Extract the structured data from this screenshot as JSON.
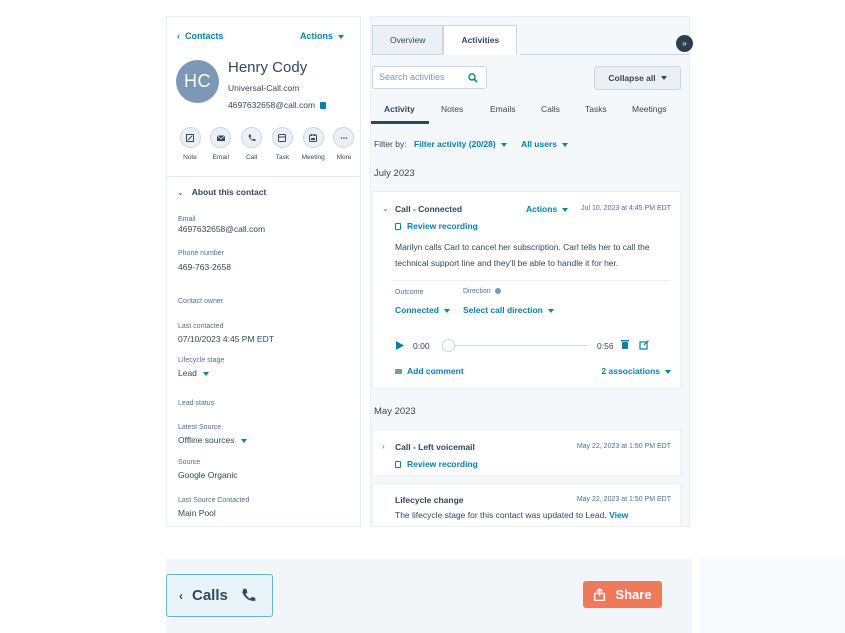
{
  "contact_panel": {
    "back_label": "Contacts",
    "actions_label": "Actions",
    "avatar_initials": "HC",
    "name": "Henry Cody",
    "domain": "Universal-Call.com",
    "email": "4697632658@call.com",
    "quick_actions": [
      {
        "label": "Note",
        "icon": "note-icon"
      },
      {
        "label": "Email",
        "icon": "email-icon"
      },
      {
        "label": "Call",
        "icon": "call-icon"
      },
      {
        "label": "Task",
        "icon": "task-icon"
      },
      {
        "label": "Meeting",
        "icon": "meeting-icon"
      },
      {
        "label": "More",
        "icon": "more-icon"
      }
    ],
    "about_title": "About this contact",
    "properties": {
      "email": {
        "label": "Email",
        "value": "4697632658@call.com"
      },
      "phone": {
        "label": "Phone number",
        "value": "469-763-2658"
      },
      "owner": {
        "label": "Contact owner",
        "value": ""
      },
      "last_contacted": {
        "label": "Last contacted",
        "value": "07/10/2023 4:45 PM EDT"
      },
      "lifecycle": {
        "label": "Lifecycle stage",
        "value": "Lead"
      },
      "lead_status": {
        "label": "Lead status",
        "value": ""
      },
      "latest_source": {
        "label": "Latest Source",
        "value": "Offline sources"
      },
      "source": {
        "label": "Source",
        "value": "Google Organic"
      },
      "last_source_contacted": {
        "label": "Last Source Contacted",
        "value": "Main Pool"
      }
    }
  },
  "activity_panel": {
    "tabs": [
      "Overview",
      "Activities"
    ],
    "active_tab": "Activities",
    "search_placeholder": "Search activities",
    "collapse_all_label": "Collapse all",
    "subtabs": [
      "Activity",
      "Notes",
      "Emails",
      "Calls",
      "Tasks",
      "Meetings"
    ],
    "filter": {
      "prefix": "Filter by:",
      "activity": "Filter activity (20/28)",
      "users": "All users"
    },
    "months": [
      "July 2023",
      "May 2023"
    ],
    "call_connected": {
      "title": "Call - Connected",
      "actions_label": "Actions",
      "date": "Jul 10, 2023 at 4:45 PM EDT",
      "review_label": "Review recording",
      "body": "Marilyn calls Carl to cancel her subscription. Carl tells her to call the technical support line and they'll be able to handle it for her.",
      "outcome_label": "Outcome",
      "outcome_value": "Connected",
      "direction_label": "Direction",
      "direction_value": "Select call direction",
      "time_start": "0:00",
      "time_end": "0:56",
      "playback_progress": 0,
      "add_comment_label": "Add comment",
      "associations_label": "2 associations"
    },
    "voicemail": {
      "title": "Call - Left voicemail",
      "date": "May 22, 2023 at 1:50 PM EDT",
      "review_label": "Review recording"
    },
    "lifecycle_change": {
      "title": "Lifecycle change",
      "date": "May 22, 2023 at 1:50 PM EDT",
      "body": "The lifecycle stage for this contact was updated to Lead.",
      "view_label": "View"
    }
  },
  "bottom_bar": {
    "calls_label": "Calls",
    "share_label": "Share"
  },
  "colors": {
    "accent": "#0b7fa8",
    "text": "#33475b",
    "avatar": "#7c98b6",
    "share": "#f0795b"
  }
}
